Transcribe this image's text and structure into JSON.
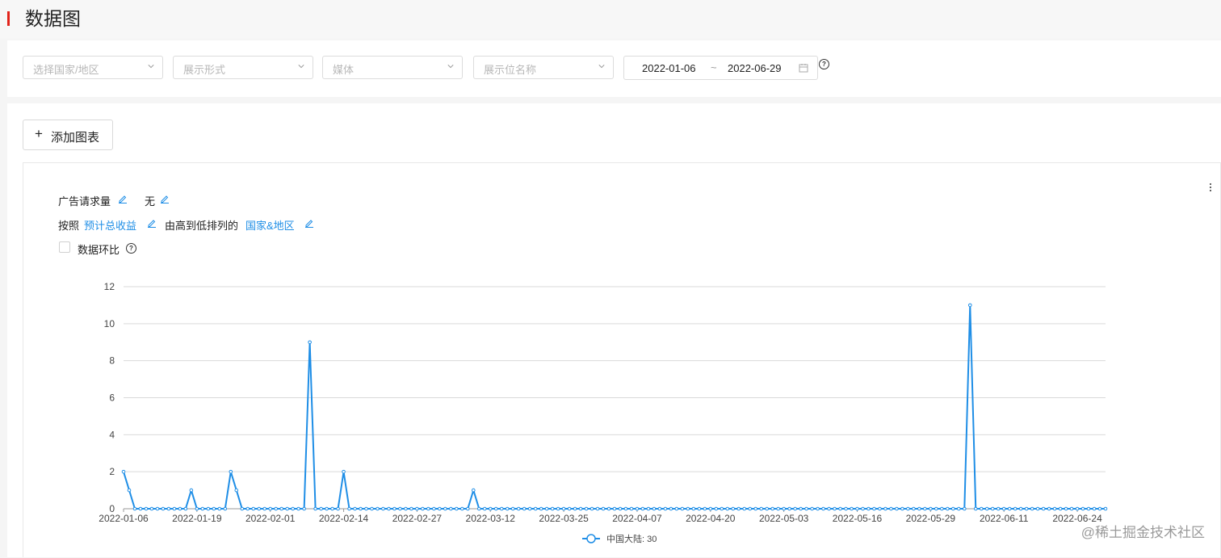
{
  "page": {
    "title": "数据图",
    "accent_color": "#e2231a"
  },
  "filters": {
    "country": {
      "placeholder": "选择国家/地区"
    },
    "display_format": {
      "placeholder": "展示形式"
    },
    "media": {
      "placeholder": "媒体"
    },
    "placement_name": {
      "placeholder": "展示位名称"
    },
    "date_range": {
      "start": "2022-01-06",
      "separator": "~",
      "end": "2022-06-29"
    }
  },
  "toolbar": {
    "add_chart_label": "添加图表",
    "add_chart_icon": "+"
  },
  "chart_config": {
    "metric_label": "广告请求量",
    "secondary_metric_label": "无",
    "sort_prefix": "按照",
    "sort_field": "预计总收益",
    "sort_middle": "由高到低排列的",
    "sort_dimension": "国家&地区",
    "compare_label": "数据环比",
    "link_color": "#1f8ee6",
    "line_color": "#1f8ee6"
  },
  "chart_data": {
    "type": "line",
    "title": "",
    "xlabel": "",
    "ylabel": "",
    "ylim": [
      0,
      12
    ],
    "yticks": [
      0,
      2,
      4,
      6,
      8,
      10,
      12
    ],
    "xtick_labels": [
      "2022-01-06",
      "2022-01-19",
      "2022-02-01",
      "2022-02-14",
      "2022-02-27",
      "2022-03-12",
      "2022-03-25",
      "2022-04-07",
      "2022-04-20",
      "2022-05-03",
      "2022-05-16",
      "2022-05-29",
      "2022-06-11",
      "2022-06-24"
    ],
    "grid": "horizontal",
    "legend_position": "bottom",
    "x_start": "2022-01-06",
    "x_end": "2022-06-29",
    "series": [
      {
        "name": "中国大陆: 30",
        "points": [
          [
            "2022-01-06",
            2
          ],
          [
            "2022-01-07",
            1
          ],
          [
            "2022-01-18",
            1
          ],
          [
            "2022-01-25",
            2
          ],
          [
            "2022-01-26",
            1
          ],
          [
            "2022-02-08",
            9
          ],
          [
            "2022-02-14",
            2
          ],
          [
            "2022-03-09",
            1
          ],
          [
            "2022-06-05",
            11
          ]
        ],
        "other_values": 0
      }
    ]
  },
  "watermark": "@稀土掘金技术社区"
}
